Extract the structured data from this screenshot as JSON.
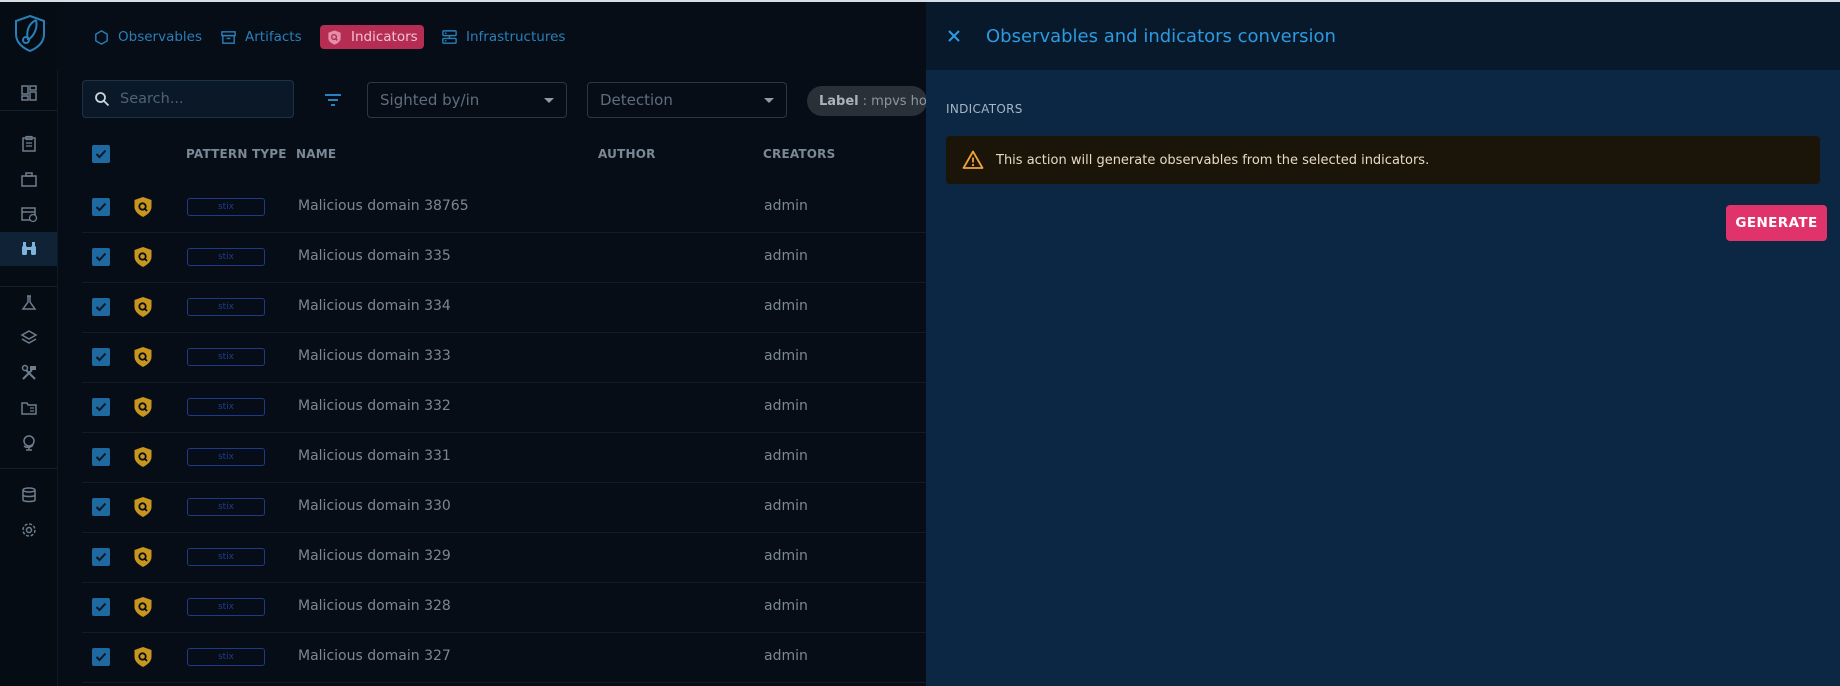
{
  "topnav": {
    "items": [
      {
        "label": "Observables",
        "icon": "hexagon-icon"
      },
      {
        "label": "Artifacts",
        "icon": "archive-icon"
      },
      {
        "label": "Indicators",
        "icon": "indicator-shield-icon",
        "active": true
      },
      {
        "label": "Infrastructures",
        "icon": "server-icon"
      }
    ]
  },
  "toolbar": {
    "search_placeholder": "Search...",
    "sighted_select": "Sighted by/in",
    "detection_select": "Detection",
    "label_chip_key": "Label",
    "label_chip_value": ": mpvs hosts"
  },
  "table": {
    "columns": [
      "PATTERN TYPE",
      "NAME",
      "AUTHOR",
      "CREATORS"
    ],
    "rows": [
      {
        "pattern": "stix",
        "name": "Malicious domain 38765",
        "author": "",
        "creator": "admin",
        "selected": true
      },
      {
        "pattern": "stix",
        "name": "Malicious domain 335",
        "author": "",
        "creator": "admin",
        "selected": true
      },
      {
        "pattern": "stix",
        "name": "Malicious domain 334",
        "author": "",
        "creator": "admin",
        "selected": true
      },
      {
        "pattern": "stix",
        "name": "Malicious domain 333",
        "author": "",
        "creator": "admin",
        "selected": true
      },
      {
        "pattern": "stix",
        "name": "Malicious domain 332",
        "author": "",
        "creator": "admin",
        "selected": true
      },
      {
        "pattern": "stix",
        "name": "Malicious domain 331",
        "author": "",
        "creator": "admin",
        "selected": true
      },
      {
        "pattern": "stix",
        "name": "Malicious domain 330",
        "author": "",
        "creator": "admin",
        "selected": true
      },
      {
        "pattern": "stix",
        "name": "Malicious domain 329",
        "author": "",
        "creator": "admin",
        "selected": true
      },
      {
        "pattern": "stix",
        "name": "Malicious domain 328",
        "author": "",
        "creator": "admin",
        "selected": true
      },
      {
        "pattern": "stix",
        "name": "Malicious domain 327",
        "author": "",
        "creator": "admin",
        "selected": true
      }
    ]
  },
  "drawer": {
    "title": "Observables and indicators conversion",
    "section": "INDICATORS",
    "alert_text": "This action will generate observables from the selected indicators.",
    "generate_label": "GENERATE"
  },
  "colors": {
    "accent": "#2d9ae0",
    "active_tab": "#b52d52",
    "generate_button": "#e0336b",
    "checkbox": "#1e6aa0",
    "indicator_icon": "#c8961c",
    "alert_icon": "#f0a33a"
  }
}
